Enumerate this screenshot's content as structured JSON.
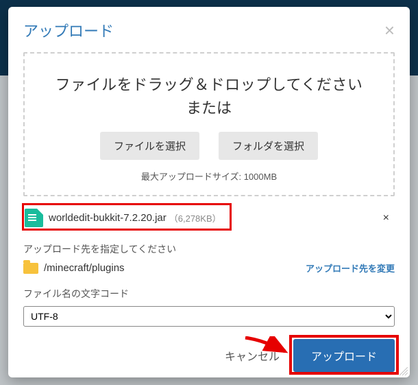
{
  "modal": {
    "title": "アップロード",
    "dropzone": {
      "line1": "ファイルをドラッグ＆ドロップしてください",
      "line2": "または",
      "select_file_label": "ファイルを選択",
      "select_folder_label": "フォルダを選択",
      "limit_text": "最大アップロードサイズ: 1000MB"
    },
    "file": {
      "name": "worldedit-bukkit-7.2.20.jar",
      "size": "（6,278KB）"
    },
    "destination": {
      "label": "アップロード先を指定してください",
      "path": "/minecraft/plugins",
      "change_label": "アップロード先を変更"
    },
    "encoding": {
      "label": "ファイル名の文字コード",
      "value": "UTF-8"
    },
    "footer": {
      "cancel_label": "キャンセル",
      "upload_label": "アップロード"
    }
  }
}
